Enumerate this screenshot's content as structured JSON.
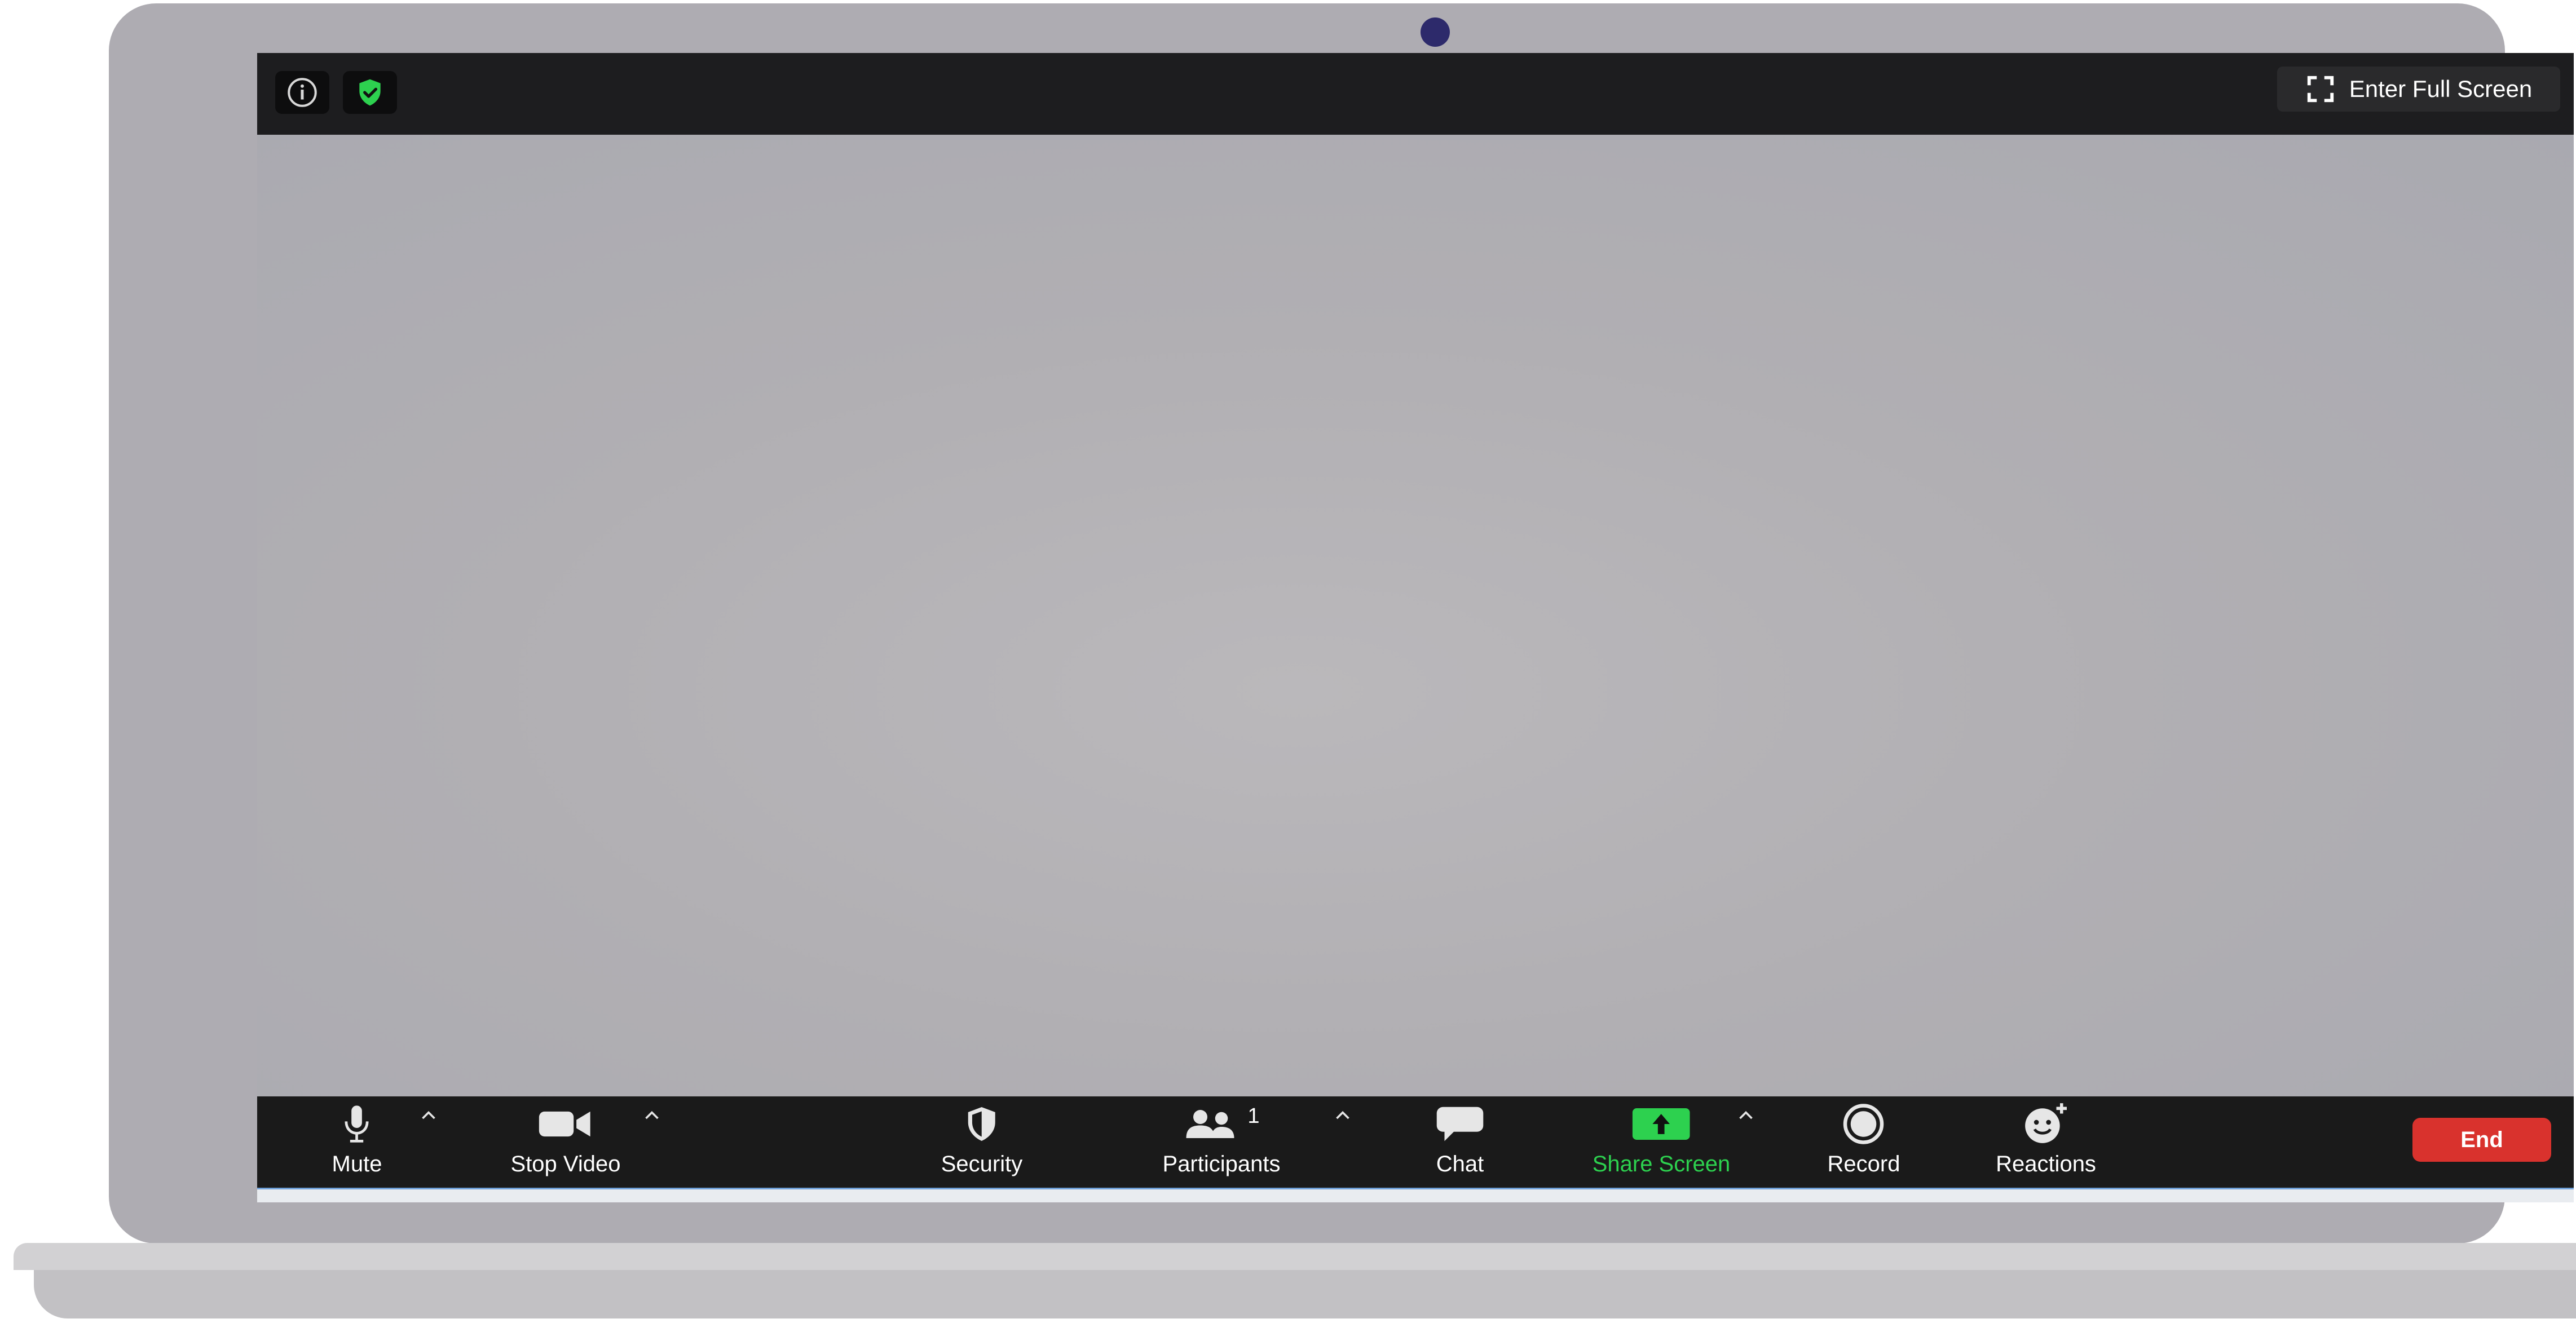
{
  "window": {
    "fullscreen_label": "Enter Full Screen"
  },
  "toolbar": {
    "mute_label": "Mute",
    "stop_video_label": "Stop Video",
    "security_label": "Security",
    "participants_label": "Participants",
    "participants_count": "1",
    "chat_label": "Chat",
    "share_screen_label": "Share Screen",
    "record_label": "Record",
    "reactions_label": "Reactions",
    "end_label": "End"
  },
  "icons": {
    "info": "info-icon",
    "secure": "shield-check-icon",
    "fullscreen": "expand-icon",
    "mute": "microphone-icon",
    "video": "video-camera-icon",
    "security": "shield-icon",
    "participants": "people-icon",
    "chat": "chat-bubble-icon",
    "share": "share-screen-arrow-icon",
    "record": "record-circle-icon",
    "reactions": "smiley-plus-icon",
    "caret": "chevron-up-icon"
  },
  "colors": {
    "toolbar_bg": "#1a1a1a",
    "share_green": "#2dd14f",
    "end_red": "#d9322d",
    "secure_green": "#2dd14f",
    "laptop_frame": "#aeacb2",
    "webcam": "#2d2a6b"
  }
}
